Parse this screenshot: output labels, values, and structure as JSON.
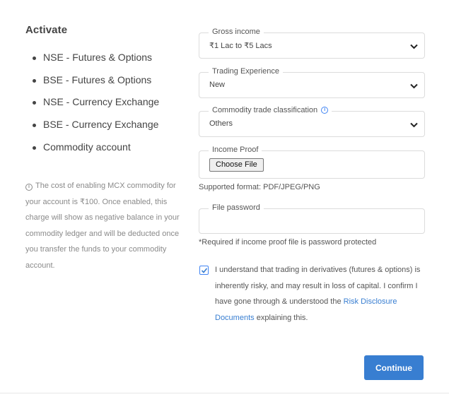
{
  "activate": {
    "title": "Activate",
    "segments": [
      "NSE - Futures & Options",
      "BSE - Futures & Options",
      "NSE - Currency Exchange",
      "BSE - Currency Exchange",
      "Commodity account"
    ],
    "note": "The cost of enabling MCX commodity for your account is ₹100. Once enabled, this charge will show as negative balance in your commodity ledger and will be deducted once you transfer the funds to your commodity account."
  },
  "form": {
    "gross_income": {
      "label": "Gross income",
      "value": "₹1 Lac to ₹5 Lacs"
    },
    "trading_experience": {
      "label": "Trading Experience",
      "value": "New"
    },
    "commodity_classification": {
      "label": "Commodity trade classification",
      "value": "Others"
    },
    "income_proof": {
      "label": "Income Proof",
      "button": "Choose File",
      "hint": "Supported format: PDF/JPEG/PNG"
    },
    "file_password": {
      "label": "File password",
      "value": "",
      "hint": "*Required if income proof file is password protected"
    }
  },
  "consent": {
    "checked": true,
    "text": "I understand that trading in derivatives (futures & options) is inherently risky, and may result in loss of capital. I confirm I have gone through & understood the",
    "link": "Risk Disclosure Documents",
    "suffix": "explaining this."
  },
  "continue_label": "Continue",
  "colors": {
    "accent": "#387ed1",
    "text": "#444444",
    "muted": "#8a8a8a",
    "border": "#dcdcdc"
  },
  "icons": {
    "info": "info-icon",
    "dropdown": "chevron-down-icon",
    "check": "check-icon"
  }
}
